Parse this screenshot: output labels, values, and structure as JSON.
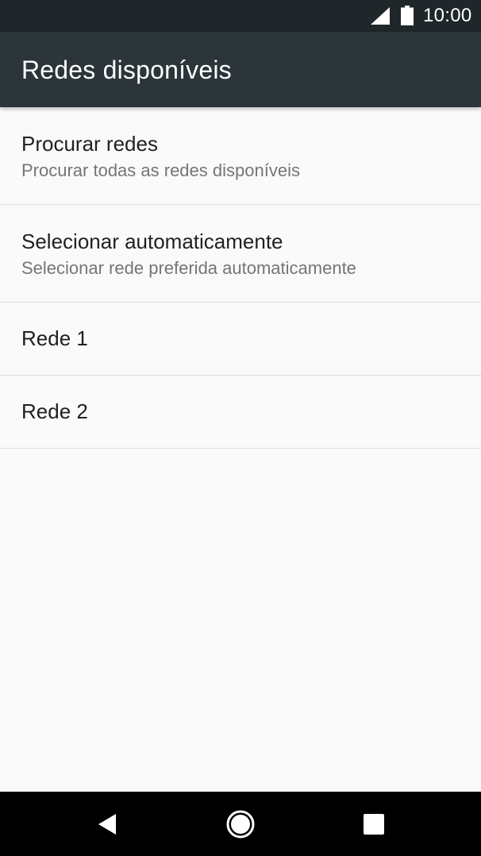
{
  "status_bar": {
    "time": "10:00",
    "icons": [
      "signal-icon",
      "battery-icon"
    ]
  },
  "app_bar": {
    "title": "Redes disponíveis"
  },
  "list": {
    "items": [
      {
        "title": "Procurar redes",
        "subtitle": "Procurar todas as redes disponíveis"
      },
      {
        "title": "Selecionar automaticamente",
        "subtitle": "Selecionar rede preferida automaticamente"
      },
      {
        "title": "Rede 1"
      },
      {
        "title": "Rede 2"
      }
    ]
  },
  "nav_bar": {
    "icons": [
      "back-icon",
      "home-icon",
      "recents-icon"
    ]
  },
  "colors": {
    "status_bar": "#1f272b",
    "app_bar": "#2b353a",
    "background": "#fafafa",
    "divider": "#dcdcdc",
    "primary_text": "#212121",
    "secondary_text": "#757575"
  }
}
